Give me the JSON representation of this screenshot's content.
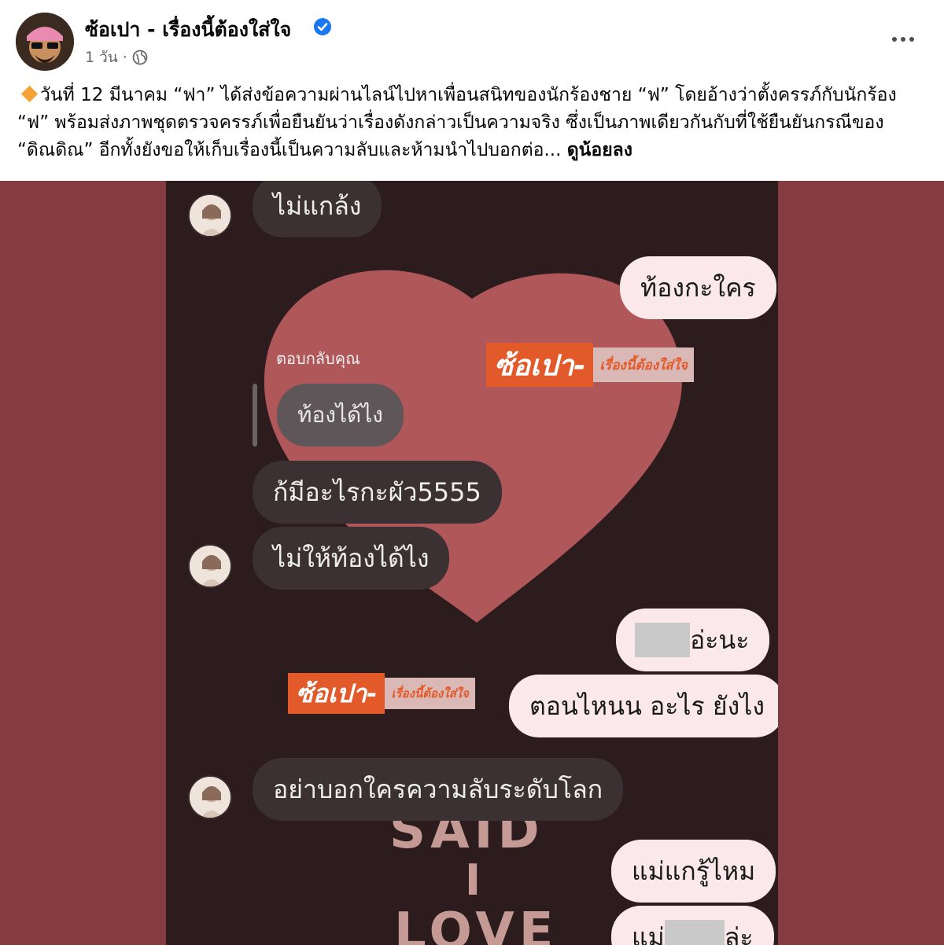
{
  "post": {
    "page_name": "ซ้อเปา - เรื่องนี้ต้องใส่ใจ",
    "time": "1 วัน",
    "separator": "·",
    "body": "วันที่ 12 มีนาคม “ฟา” ได้ส่งข้อความผ่านไลน์ไปหาเพื่อนสนิทของนักร้องชาย “ฟ” โดยอ้างว่าตั้งครรภ์กับนักร้อง “ฟ” พร้อมส่งภาพชุดตรวจครรภ์เพื่อยืนยันว่าเรื่องดังกล่าวเป็นความจริง ซึ่งเป็นภาพเดียวกันกับที่ใช้ยืนยันกรณีของ “ดิณดิณ” อีกทั้งยังขอให้เก็บเรื่องนี้เป็นความลับและห้ามนำไปบอกต่อ...",
    "see_less": "ดูน้อยลง"
  },
  "chat": {
    "msg1": "ไม่แกล้ง",
    "msg2": "ท้องกะใคร",
    "reply_label": "ตอบกลับคุณ",
    "quoted": "ท้องได้ไง",
    "msg3": "ก้มีอะไรกะผัว5555",
    "msg4": "ไม่ให้ท้องได้ไง",
    "msg5": "อ่ะนะ",
    "msg6": "ตอนไหนน อะไร ยังไง",
    "msg7": "อย่าบอกใครความลับระดับโลก",
    "msg8": "แม่แกรู้ไหม",
    "msg9_a": "แม่",
    "msg9_b": "ล่ะ"
  },
  "watermark": {
    "main": "ซ้อเปา-",
    "sub": "เรื่องนี้ต้องใส่ใจ"
  },
  "background_text": {
    "line1": "SAID",
    "line2": "I",
    "line3": "LOVE"
  },
  "colors": {
    "verified": "#1877f2",
    "image_bg": "#843c40",
    "chat_bg": "#2c1c1e",
    "heart": "#b0575a",
    "watermark": "#e35a2a"
  },
  "icons": [
    "verified-badge-icon",
    "globe-icon",
    "more-options-icon",
    "diamond-icon"
  ]
}
